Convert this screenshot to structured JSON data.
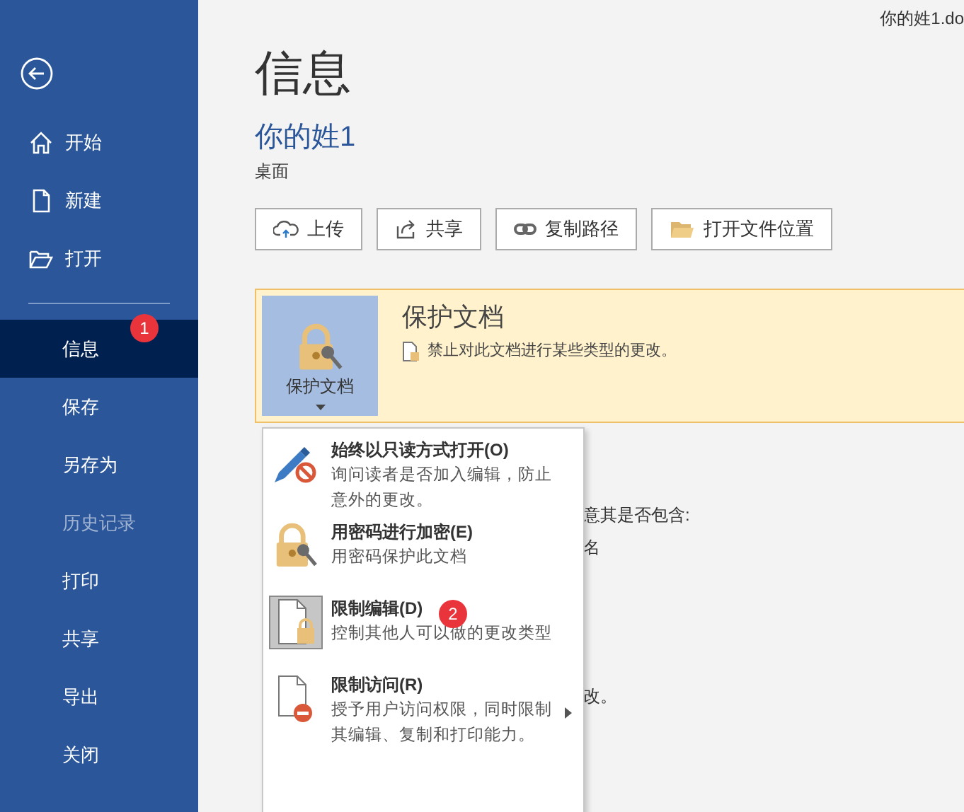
{
  "file_name": "你的姓1.do",
  "sidebar": {
    "items": [
      {
        "label": "开始",
        "kind": "home",
        "selected": false,
        "disabled": false
      },
      {
        "label": "新建",
        "kind": "new",
        "selected": false,
        "disabled": false
      },
      {
        "label": "打开",
        "kind": "open",
        "selected": false,
        "disabled": false
      },
      {
        "label": "信息",
        "kind": "plain",
        "selected": true,
        "disabled": false,
        "badge": "1"
      },
      {
        "label": "保存",
        "kind": "plain",
        "selected": false,
        "disabled": false
      },
      {
        "label": "另存为",
        "kind": "plain",
        "selected": false,
        "disabled": false
      },
      {
        "label": "历史记录",
        "kind": "plain",
        "selected": false,
        "disabled": true
      },
      {
        "label": "打印",
        "kind": "plain",
        "selected": false,
        "disabled": false
      },
      {
        "label": "共享",
        "kind": "plain",
        "selected": false,
        "disabled": false
      },
      {
        "label": "导出",
        "kind": "plain",
        "selected": false,
        "disabled": false
      },
      {
        "label": "关闭",
        "kind": "plain",
        "selected": false,
        "disabled": false
      }
    ]
  },
  "title": "信息",
  "doc_name": "你的姓1",
  "location": "桌面",
  "buttons": [
    {
      "label": "上传",
      "kind": "upload"
    },
    {
      "label": "共享",
      "kind": "share"
    },
    {
      "label": "复制路径",
      "kind": "link"
    },
    {
      "label": "打开文件位置",
      "kind": "folder"
    }
  ],
  "protect": {
    "button_label": "保护文档",
    "title": "保护文档",
    "description": "禁止对此文档进行某些类型的更改。"
  },
  "background_texts": [
    "意其是否包含:",
    "名",
    "改。"
  ],
  "menu": {
    "badge": "2",
    "items": [
      {
        "kind": "pencil",
        "title": "始终以只读方式打开(O)",
        "description": "询问读者是否加入编辑，防止意外的更改。",
        "highlighted": false,
        "submenu": false
      },
      {
        "kind": "lock",
        "title": "用密码进行加密(E)",
        "description": "用密码保护此文档",
        "highlighted": false,
        "submenu": false
      },
      {
        "kind": "doclock",
        "title": "限制编辑(D)",
        "description": "控制其他人可以做的更改类型",
        "highlighted": true,
        "submenu": false
      },
      {
        "kind": "docstop",
        "title": "限制访问(R)",
        "description": "授予用户访问权限，同时限制其编辑、复制和打印能力。",
        "highlighted": false,
        "submenu": true
      }
    ]
  }
}
